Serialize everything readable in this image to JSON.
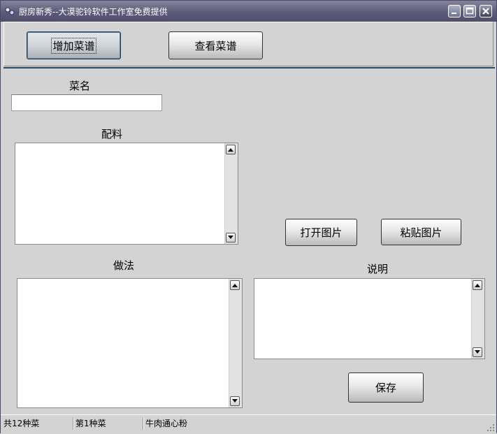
{
  "window": {
    "title": "厨房新秀--大漠驼铃软件工作室免费提供"
  },
  "toolbar": {
    "add_recipe": "增加菜谱",
    "view_recipe": "查看菜谱"
  },
  "form": {
    "name_label": "菜名",
    "name_value": "",
    "ingredients_label": "配料",
    "method_label": "做法",
    "description_label": "说明",
    "open_image": "打开图片",
    "paste_image": "粘贴图片",
    "save": "保存"
  },
  "status": {
    "total": "共12种菜",
    "index": "第1种菜",
    "current": "牛肉通心粉"
  }
}
